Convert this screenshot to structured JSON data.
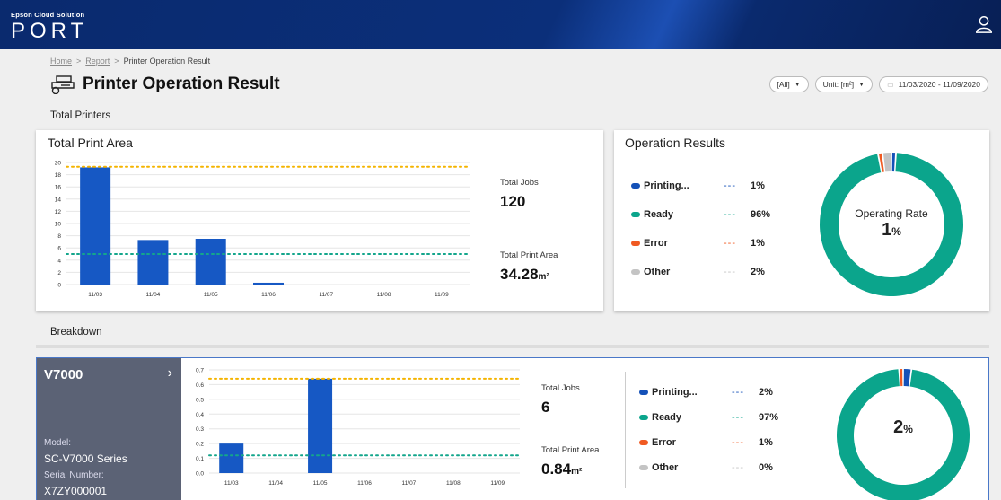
{
  "header": {
    "brand_small": "Epson Cloud Solution",
    "brand_big": "PORT"
  },
  "breadcrumb": {
    "home": "Home",
    "report": "Report",
    "current": "Printer Operation Result",
    "separator": ">"
  },
  "page": {
    "title": "Printer Operation Result"
  },
  "filters": {
    "scope": "[All]",
    "unit": "Unit: [m²]",
    "date_range": "11/03/2020 - 11/09/2020"
  },
  "sections": {
    "total_printers": "Total Printers",
    "breakdown": "Breakdown"
  },
  "colors": {
    "printing": "#1451b8",
    "ready": "#0ba58c",
    "error": "#f05a22",
    "other": "#c4c4c4",
    "bar": "#1658c4",
    "upper_line": "#f4b400",
    "lower_line": "#14a68c"
  },
  "total_print_area_card": {
    "title": "Total Print Area",
    "total_jobs_label": "Total Jobs",
    "total_jobs": "120",
    "total_area_label": "Total Print Area",
    "total_area": "34.28",
    "unit": "m²"
  },
  "operation_card": {
    "title": "Operation Results",
    "legend": [
      {
        "name": "Printing...",
        "pct": "1%",
        "color": "#1451b8"
      },
      {
        "name": "Ready",
        "pct": "96%",
        "color": "#0ba58c"
      },
      {
        "name": "Error",
        "pct": "1%",
        "color": "#f05a22"
      },
      {
        "name": "Other",
        "pct": "2%",
        "color": "#c4c4c4"
      }
    ],
    "dash": "---",
    "rate_label": "Operating Rate",
    "rate_value": "1",
    "rate_unit": "%"
  },
  "v7000": {
    "name": "V7000",
    "model_label": "Model:",
    "model": "SC-V7000 Series",
    "serial_label": "Serial Number:",
    "serial": "X7ZY000001",
    "total_jobs_label": "Total Jobs",
    "total_jobs": "6",
    "total_area_label": "Total Print Area",
    "total_area": "0.84",
    "unit": "m²",
    "legend": [
      {
        "name": "Printing...",
        "pct": "2%",
        "color": "#1451b8"
      },
      {
        "name": "Ready",
        "pct": "97%",
        "color": "#0ba58c"
      },
      {
        "name": "Error",
        "pct": "1%",
        "color": "#f05a22"
      },
      {
        "name": "Other",
        "pct": "0%",
        "color": "#c4c4c4"
      }
    ],
    "rate_value": "2",
    "rate_unit": "%"
  },
  "chart_data": [
    {
      "type": "bar",
      "categories": [
        "11/03",
        "11/04",
        "11/05",
        "11/06",
        "11/07",
        "11/08",
        "11/09"
      ],
      "values": [
        19.2,
        7.3,
        7.5,
        0.3,
        0,
        0,
        0
      ],
      "ylim": [
        0,
        20
      ],
      "yticks": [
        0,
        2,
        4,
        6,
        8,
        10,
        12,
        14,
        16,
        18,
        20
      ],
      "reference_lines": [
        19.3,
        5.0
      ],
      "grid": true
    },
    {
      "type": "pie",
      "labels": [
        "Printing...",
        "Ready",
        "Error",
        "Other"
      ],
      "values": [
        1,
        96,
        1,
        2
      ]
    },
    {
      "type": "bar",
      "categories": [
        "11/03",
        "11/04",
        "11/05",
        "11/06",
        "11/07",
        "11/08",
        "11/09"
      ],
      "values": [
        0.2,
        0,
        0.64,
        0,
        0,
        0,
        0
      ],
      "ylim": [
        0,
        0.7
      ],
      "yticks": [
        0,
        0.1,
        0.2,
        0.3,
        0.4,
        0.5,
        0.6,
        0.7
      ],
      "reference_lines": [
        0.64,
        0.12
      ],
      "grid": true
    },
    {
      "type": "pie",
      "labels": [
        "Printing...",
        "Ready",
        "Error",
        "Other"
      ],
      "values": [
        2,
        97,
        1,
        0
      ]
    }
  ]
}
